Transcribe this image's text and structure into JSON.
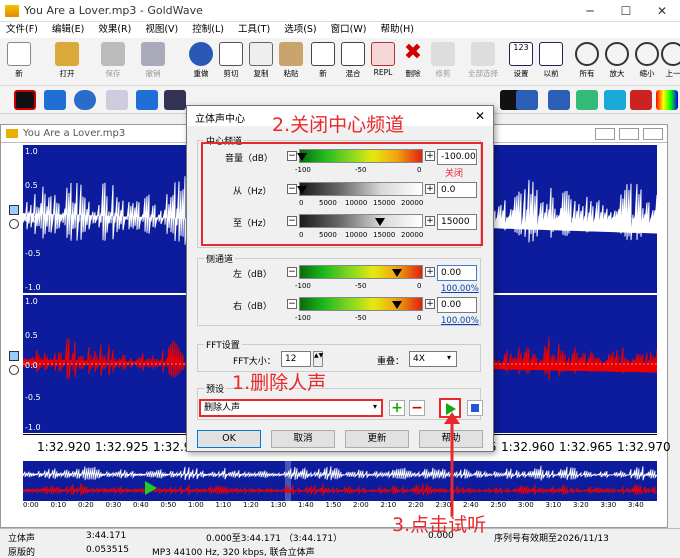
{
  "window": {
    "title": "You Are a Lover.mp3 - GoldWave"
  },
  "menu": [
    "文件(F)",
    "编辑(E)",
    "效果(R)",
    "视图(V)",
    "控制(L)",
    "工具(T)",
    "选项(S)",
    "窗口(W)",
    "帮助(H)"
  ],
  "toolbar": [
    "新",
    "打开",
    "保存",
    "撤销",
    "重做",
    "剪切",
    "复制",
    "粘贴",
    "新",
    "混合",
    "REPL",
    "删除",
    "修剪",
    "全部选择",
    "设置",
    "以前",
    "所有",
    "放大",
    "缩小",
    "上一"
  ],
  "wave": {
    "title": "You Are a Lover.mp3",
    "axis": [
      "1.0",
      "0.5",
      "0.0",
      "-0.5",
      "-1.0"
    ],
    "timeline": [
      "1:32.920",
      "1:32.925",
      "1:32.930",
      "1:32.935",
      "1:32.940",
      "1:32.945",
      "1:32.950",
      "1:32.955",
      "1:32.960",
      "1:32.965",
      "1:32.970"
    ],
    "overview_ticks": [
      "0:00",
      "0:10",
      "0:20",
      "0:30",
      "0:40",
      "0:50",
      "1:00",
      "1:10",
      "1:20",
      "1:30",
      "1:40",
      "1:50",
      "2:00",
      "2:10",
      "2:20",
      "2:30",
      "2:40",
      "2:50",
      "3:00",
      "3:10",
      "3:20",
      "3:30",
      "3:40"
    ]
  },
  "dialog": {
    "title": "立体声中心",
    "center_group": "中心频道",
    "volume_label": "音量（dB）",
    "volume_value": "-100.00",
    "volume_ticks": [
      "-100",
      "-50",
      "0"
    ],
    "closed_note": "关闭",
    "from_label": "从（Hz）",
    "from_value": "0.0",
    "freq_ticks": [
      "0",
      "5000",
      "10000",
      "15000",
      "20000"
    ],
    "to_label": "至（Hz）",
    "to_value": "15000",
    "side_group": "侧通道",
    "left_label": "左（dB）",
    "left_value": "0.00",
    "left_pct": "100.00%",
    "right_label": "右（dB）",
    "right_value": "0.00",
    "right_pct": "100.00%",
    "fft_group": "FFT设置",
    "fft_size_label": "FFT大小：",
    "fft_size_value": "12",
    "overlap_label": "重叠：",
    "overlap_value": "4X",
    "preset_group": "预设",
    "preset_value": "删除人声",
    "ok": "OK",
    "cancel": "取消",
    "update": "更新",
    "help": "帮助"
  },
  "annotations": {
    "a1": "1.删除人声",
    "a2": "2.关闭中心频道",
    "a3": "3.点击试听"
  },
  "status": {
    "r1": [
      "立体声",
      "3:44.171",
      "0.000至3:44.171 （3:44.171）",
      "0.000",
      "序列号有效期至2026/11/13"
    ],
    "r2": [
      "原版的",
      "0.053515",
      "MP3 44100 Hz, 320 kbps, 联合立体声"
    ]
  }
}
